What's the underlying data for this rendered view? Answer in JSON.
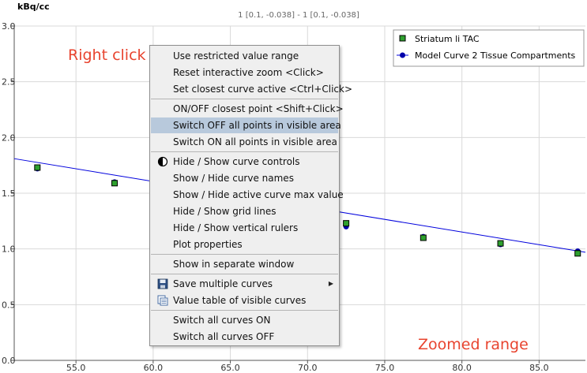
{
  "plot": {
    "ylabel": "kBq/cc",
    "subtitle": "1 [0.1, -0.038] - 1 [0.1, -0.038]",
    "yticks": [
      "0.0",
      "0.5",
      "1.0",
      "1.5",
      "2.0",
      "2.5",
      "3.0"
    ],
    "xticks": [
      "55.0",
      "60.0",
      "65.0",
      "70.0",
      "75.0",
      "80.0",
      "85.0"
    ],
    "annotation_top": "Right click",
    "annotation_bottom": "Zoomed range"
  },
  "legend": {
    "items": [
      {
        "label": "Striatum li TAC",
        "marker": "green-square"
      },
      {
        "label": "Model Curve 2 Tissue Compartments",
        "marker": "blue-circle"
      }
    ]
  },
  "colors": {
    "tac_marker": "#2ea02e",
    "model_line": "#0000dd",
    "annotation": "#e8442f",
    "menu_highlight": "#b8c9dc"
  },
  "chart_data": {
    "type": "scatter",
    "ylabel": "kBq/cc",
    "xlabel": "",
    "xlim": [
      51.0,
      88.0
    ],
    "ylim": [
      0.0,
      3.0
    ],
    "grid": true,
    "legend_position": "top-right",
    "series": [
      {
        "name": "Striatum li TAC",
        "x": [
          52.5,
          57.5,
          72.5,
          77.5,
          82.5,
          87.5
        ],
        "y": [
          1.73,
          1.59,
          1.23,
          1.1,
          1.05,
          0.96
        ]
      },
      {
        "name": "Model Curve 2 Tissue Compartments",
        "x": [
          52.5,
          57.5,
          72.5,
          77.5,
          82.5,
          87.5
        ],
        "y": [
          1.72,
          1.6,
          1.2,
          1.11,
          1.04,
          0.98
        ]
      }
    ],
    "model_line": {
      "x": [
        51.0,
        88.0
      ],
      "y": [
        1.81,
        0.97
      ]
    }
  },
  "context_menu": {
    "items": [
      {
        "label": "Use restricted value range"
      },
      {
        "label": "Reset interactive zoom <Click>"
      },
      {
        "label": "Set closest curve active <Ctrl+Click>"
      },
      {
        "label": "ON/OFF closest point <Shift+Click>"
      },
      {
        "label": "Switch OFF all points in visible area"
      },
      {
        "label": "Switch ON all points in visible area"
      },
      {
        "label": "Hide / Show curve controls"
      },
      {
        "label": "Show / Hide curve names"
      },
      {
        "label": "Show / Hide active curve max value"
      },
      {
        "label": "Hide / Show grid lines"
      },
      {
        "label": "Hide / Show vertical rulers"
      },
      {
        "label": "Plot properties"
      },
      {
        "label": "Show in separate window"
      },
      {
        "label": "Save multiple curves"
      },
      {
        "label": "Value table of visible curves"
      },
      {
        "label": "Switch all curves ON"
      },
      {
        "label": "Switch all curves OFF"
      }
    ]
  }
}
